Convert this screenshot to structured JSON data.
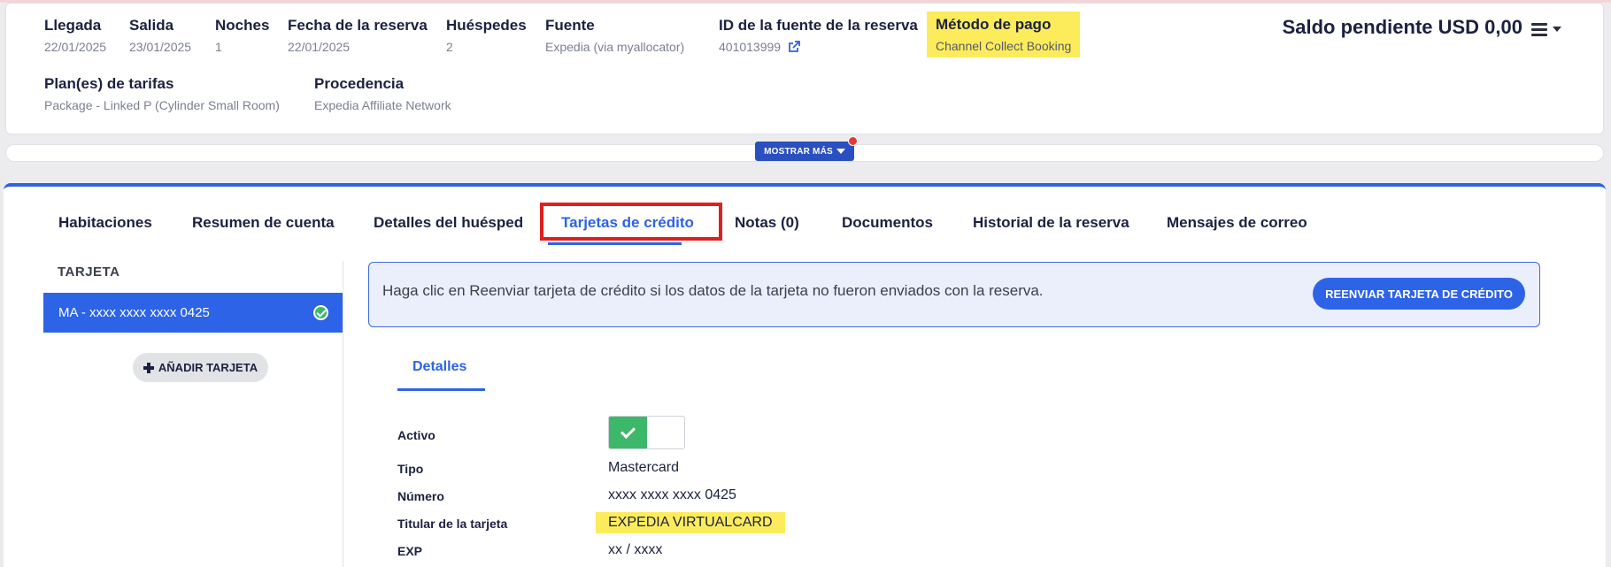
{
  "reservation": {
    "fields": [
      {
        "label": "Llegada",
        "value": "22/01/2025"
      },
      {
        "label": "Salida",
        "value": "23/01/2025"
      },
      {
        "label": "Noches",
        "value": "1"
      },
      {
        "label": "Fecha de la reserva",
        "value": "22/01/2025"
      },
      {
        "label": "Huéspedes",
        "value": "2"
      },
      {
        "label": "Fuente",
        "value": "Expedia (via myallocator)"
      },
      {
        "label": "ID de la fuente de la reserva",
        "value": "401013999"
      },
      {
        "label": "Método de pago",
        "value": "Channel Collect Booking"
      },
      {
        "label": "Plan(es) de tarifas",
        "value": "Package - Linked P (Cylinder Small Room)"
      },
      {
        "label": "Procedencia",
        "value": "Expedia Affiliate Network"
      }
    ],
    "balance": "Saldo pendiente USD 0,00",
    "menu_icon": "hamburger-menu-icon",
    "source_link_icon": "external-link-icon",
    "highlight_color": "#fcec5c"
  },
  "show_more": {
    "label": "MOSTRAR MÁS"
  },
  "tabs": [
    {
      "label": "Habitaciones"
    },
    {
      "label": "Resumen de cuenta"
    },
    {
      "label": "Detalles del huésped"
    },
    {
      "label": "Tarjetas de crédito",
      "active": true
    },
    {
      "label": "Notas (0)"
    },
    {
      "label": "Documentos"
    },
    {
      "label": "Historial de la reserva"
    },
    {
      "label": "Mensajes de correo"
    }
  ],
  "cards": {
    "column_title": "TARJETA",
    "items": [
      {
        "label": "MA - xxxx xxxx xxxx 0425",
        "verified": true
      }
    ],
    "add_button": "AÑADIR TARJETA"
  },
  "info": {
    "text": "Haga clic en Reenviar tarjeta de crédito si los datos de la tarjeta no fueron enviados con la reserva.",
    "resend_button": "REENVIAR TARJETA DE CRÉDITO"
  },
  "details": {
    "tab_label": "Detalles",
    "rows": [
      {
        "label": "Activo",
        "value": ""
      },
      {
        "label": "Tipo",
        "value": "Mastercard"
      },
      {
        "label": "Número",
        "value": "xxxx xxxx xxxx 0425"
      },
      {
        "label": "Titular de la tarjeta",
        "value": "EXPEDIA VIRTUALCARD"
      },
      {
        "label": "EXP",
        "value": "xx / xxxx"
      }
    ],
    "active_toggle_on": true
  },
  "colors": {
    "accent": "#2d63e6",
    "success": "#3db86a",
    "highlight_border": "#e01f1f"
  }
}
